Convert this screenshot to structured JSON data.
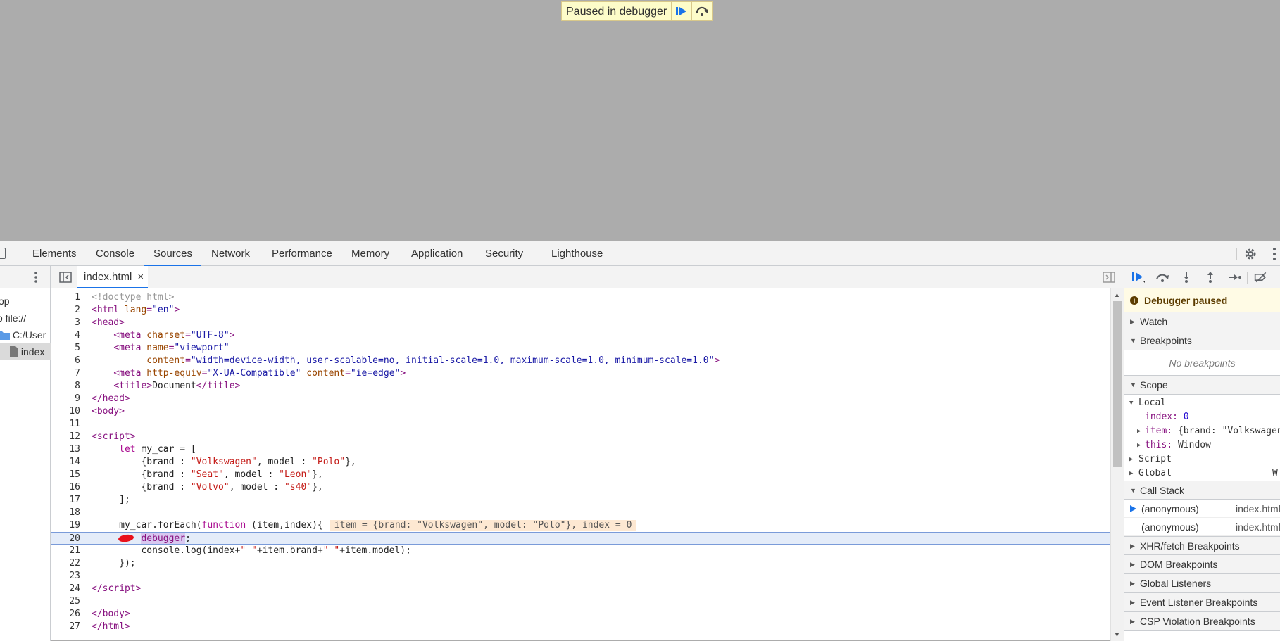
{
  "banner": {
    "text": "Paused in debugger"
  },
  "tabs": [
    {
      "label": "Elements"
    },
    {
      "label": "Console"
    },
    {
      "label": "Sources"
    },
    {
      "label": "Network"
    },
    {
      "label": "Performance"
    },
    {
      "label": "Memory"
    },
    {
      "label": "Application"
    },
    {
      "label": "Security"
    },
    {
      "label": "Lighthouse"
    }
  ],
  "active_tab": "Sources",
  "navigator": {
    "items": [
      {
        "label": "op"
      },
      {
        "label": "o file://"
      },
      {
        "label": "C:/User"
      },
      {
        "label": "index"
      }
    ]
  },
  "editor": {
    "file_tab": "index.html",
    "close_glyph": "×",
    "line_numbers": [
      "1",
      "2",
      "3",
      "4",
      "5",
      "6",
      "7",
      "8",
      "9",
      "10",
      "11",
      "12",
      "13",
      "14",
      "15",
      "16",
      "17",
      "18",
      "19",
      "20",
      "21",
      "22",
      "23",
      "24",
      "25",
      "26",
      "27"
    ],
    "inline_value": "item = {brand: \"Volkswagen\", model: \"Polo\"}, index = 0"
  },
  "debugger": {
    "paused_title": "Debugger paused",
    "sections": {
      "watch": "Watch",
      "breakpoints": "Breakpoints",
      "no_breakpoints": "No breakpoints",
      "scope": "Scope",
      "call_stack": "Call Stack",
      "xhr": "XHR/fetch Breakpoints",
      "dom": "DOM Breakpoints",
      "global_listeners": "Global Listeners",
      "event_listener": "Event Listener Breakpoints",
      "csp": "CSP Violation Breakpoints"
    },
    "scope": {
      "local": "Local",
      "index_key": "index:",
      "index_val": "0",
      "item_key": "item:",
      "item_val": "{brand: \"Volkswagen\"",
      "this_key": "this:",
      "this_val": "Window",
      "script": "Script",
      "global": "Global",
      "global_val": "W"
    },
    "call_stack": [
      {
        "fn": "(anonymous)",
        "loc": "index.html"
      },
      {
        "fn": "(anonymous)",
        "loc": "index.html"
      }
    ]
  },
  "colors": {
    "accent": "#1a73e8",
    "breakpoint": "#e8111b",
    "banner_bg": "#fdfcc9"
  }
}
